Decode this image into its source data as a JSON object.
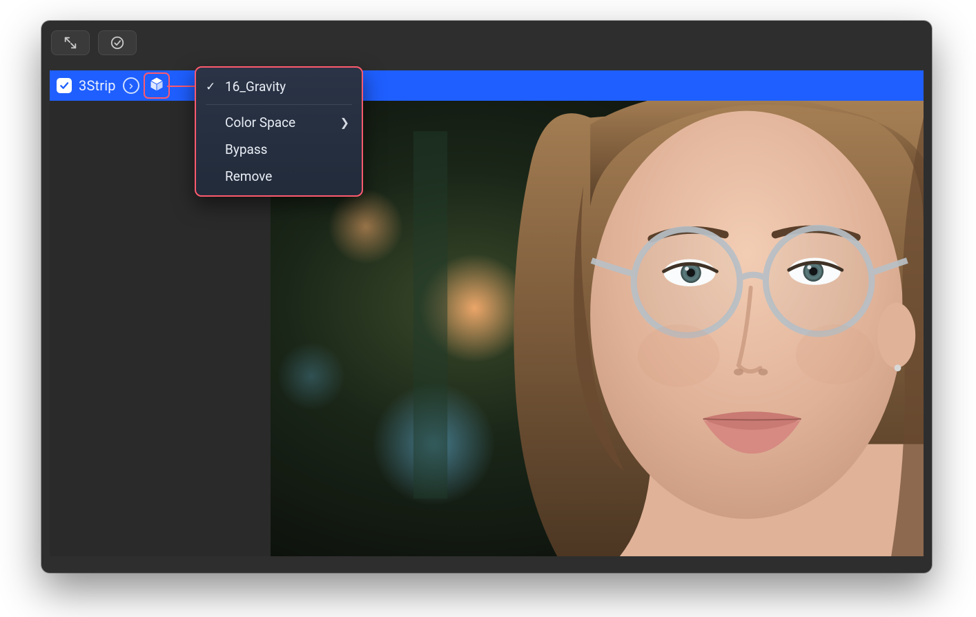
{
  "toolbar": {
    "tool1_icon": "expand-diagonal-icon",
    "tool2_icon": "checkmark-circle-icon"
  },
  "layer": {
    "checked": true,
    "name": "3Strip",
    "nav_icon": "circle-arrow-right-icon",
    "cube_icon": "cube-icon"
  },
  "menu": {
    "selected_label": "16_Gravity",
    "items": [
      {
        "label": "Color Space",
        "has_submenu": true
      },
      {
        "label": "Bypass",
        "has_submenu": false
      },
      {
        "label": "Remove",
        "has_submenu": false
      }
    ]
  },
  "highlight_color": "#ff5a6e",
  "accent_color": "#1f5fff",
  "viewer": {
    "description": "portrait photo of a woman with glasses, warm cinematic grade, bokeh background"
  }
}
